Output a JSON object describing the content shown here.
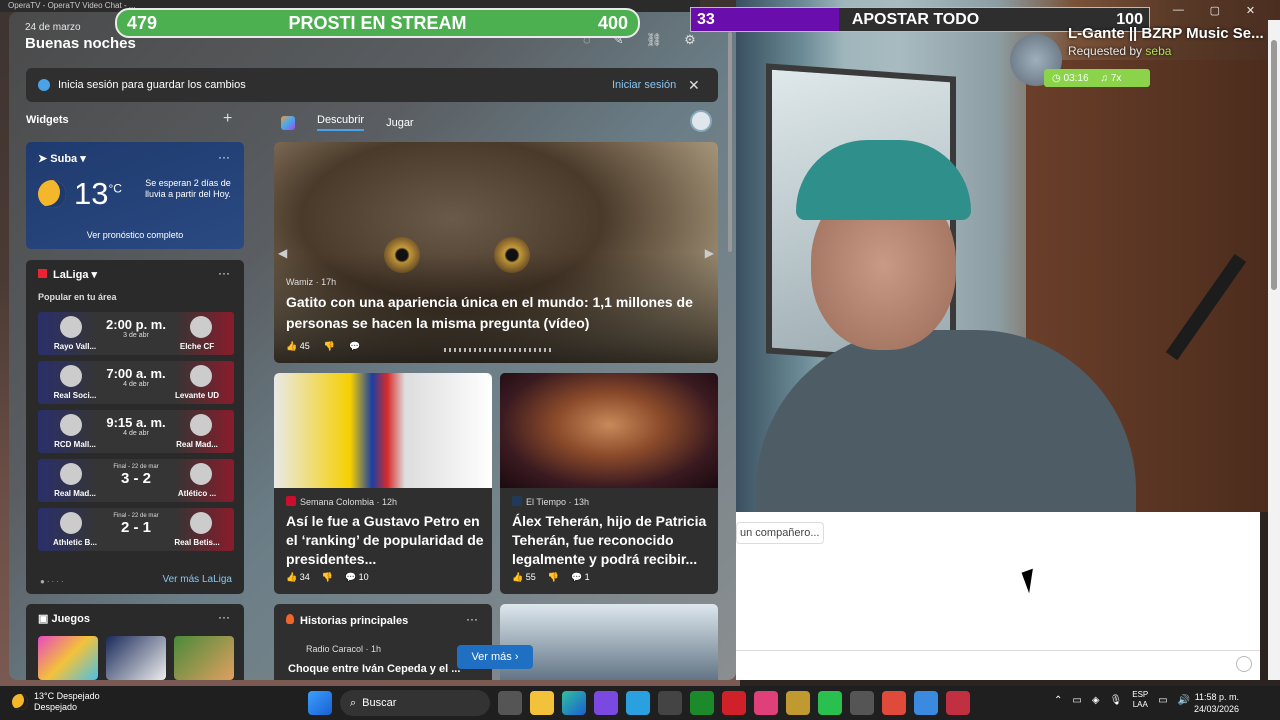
{
  "tabstrip": {
    "text": "OperaTV - OperaTV Video Chat - ..."
  },
  "overlay": {
    "bar1": {
      "left": "479",
      "title": "PROSTI EN STREAM",
      "right": "400"
    },
    "bar2": {
      "left": "33",
      "title": "APOSTAR TODO",
      "right": "100"
    },
    "music": {
      "title": "L-Gante || BZRP Music Se...",
      "requested_prefix": "Requested by",
      "requester": "seba",
      "time": "03:16",
      "count": "7x"
    }
  },
  "panel": {
    "date": "24 de marzo",
    "greeting": "Buenas noches",
    "signin_text": "Inicia sesión para guardar los cambios",
    "signin_action": "Iniciar sesión",
    "widgets_title": "Widgets",
    "weather": {
      "location": "Suba",
      "temp": "13",
      "unit": "°C",
      "forecast": "Se esperan 2 días de lluvia a partir del Hoy.",
      "full_link": "Ver pronóstico completo"
    },
    "laliga": {
      "title": "LaLiga",
      "popular": "Popular en tu área",
      "matches": [
        {
          "home": "Rayo Vall...",
          "away": "Elche CF",
          "main": "2:00 p. m.",
          "sub": "3 de abr"
        },
        {
          "home": "Real Soci...",
          "away": "Levante UD",
          "main": "7:00 a. m.",
          "sub": "4 de abr"
        },
        {
          "home": "RCD Mall...",
          "away": "Real Mad...",
          "main": "9:15 a. m.",
          "sub": "4 de abr"
        },
        {
          "home": "Real Mad...",
          "away": "Atlético ...",
          "main": "3 - 2",
          "sub": "Final - 22 de mar"
        },
        {
          "home": "Athletic B...",
          "away": "Real Betis...",
          "main": "2 - 1",
          "sub": "Final - 22 de mar"
        }
      ],
      "more": "Ver más LaLiga"
    },
    "games_title": "Juegos",
    "feed_tabs": [
      "Descubrir",
      "Jugar"
    ],
    "hero": {
      "source": "Wamiz · 17h",
      "title": "Gatito con una apariencia única en el mundo: 1,1 millones de personas se hacen la misma pregunta (vídeo)",
      "likes": "45"
    },
    "news": [
      {
        "source": "Semana Colombia · 12h",
        "title": "Así le fue a Gustavo Petro en el ‘ranking’ de popularidad de presidentes...",
        "likes": "34",
        "comments": "10"
      },
      {
        "source": "El Tiempo · 13h",
        "title": "Álex Teherán, hijo de Patricia Teherán, fue reconocido legalmente y podrá recibir...",
        "likes": "55",
        "comments": "1"
      }
    ],
    "top_stories": {
      "title": "Historias principales",
      "source": "Radio Caracol · 1h",
      "headline": "Choque entre Iván Cepeda y el ..."
    },
    "see_more": "Ver más"
  },
  "chat": {
    "hint": "un compañero..."
  },
  "taskbar": {
    "weather_temp": "13°C Despejado",
    "weather_desc": "Despejado",
    "search": "Buscar",
    "lang1": "ESP",
    "lang2": "LAA",
    "time": "11:58 p. m.",
    "date": "24/03/2026"
  }
}
